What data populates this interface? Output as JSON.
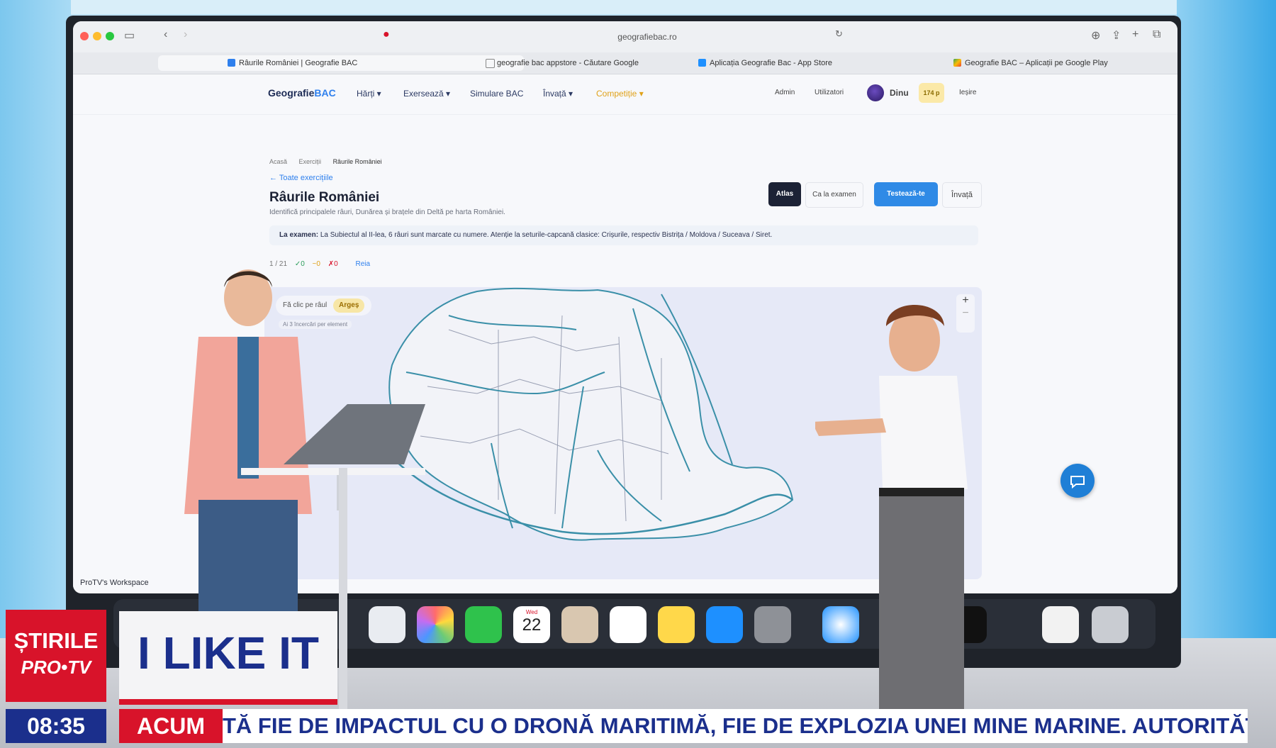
{
  "browser": {
    "url": "geografiebac.ro",
    "tabs": [
      {
        "label": "Râurile României | Geografie BAC"
      },
      {
        "label": "geografie bac appstore - Căutare Google"
      },
      {
        "label": "Aplicația Geografie Bac - App Store"
      },
      {
        "label": "Geografie BAC – Aplicații pe Google Play"
      }
    ]
  },
  "nav": {
    "logo_main": "Geografie",
    "logo_accent": "BAC",
    "items": [
      "Hărți ▾",
      "Exersează ▾",
      "Simulare BAC",
      "Învață ▾",
      "Competiție ▾"
    ],
    "admin": "Admin",
    "users": "Utilizatori",
    "user_name": "Dinu",
    "points": "174 p",
    "logout": "Ieșire"
  },
  "breadcrumb": [
    "Acasă",
    "Exerciții",
    "Râurile României"
  ],
  "back_link": "← Toate exercițiile",
  "page": {
    "title": "Râurile României",
    "subtitle": "Identifică principalele râuri, Dunărea și brațele din Deltă pe harta României."
  },
  "modes": {
    "atlas": "Atlas",
    "exam": "Ca la examen",
    "test": "Testează-te",
    "learn": "Învață"
  },
  "exam_note": {
    "label": "La examen:",
    "text": "La Subiectul al II-lea, 6 râuri sunt marcate cu numere. Atenție la seturile-capcană clasice: Crișurile, respectiv Bistrița / Moldova / Suceava / Siret."
  },
  "stats": {
    "progress": "1 / 21",
    "correct": "✓0",
    "partial": "~0",
    "wrong": "✗0",
    "reset": "Reia"
  },
  "map": {
    "prompt": "Fă clic pe râul",
    "river": "Argeș",
    "hint": "Ai 3 încercări per element",
    "zoom_in": "+",
    "zoom_out": "−"
  },
  "workspace": "ProTV's Workspace",
  "dock": {
    "calendar_month": "Wed",
    "calendar_day": "22"
  },
  "broadcast": {
    "channel_line1": "ȘTIRILE",
    "channel_line2": "PRO•TV",
    "show": "I LIKE IT",
    "time": "08:35",
    "now": "ACUM",
    "ticker": "TĂ FIE DE IMPACTUL CU O DRONĂ MARITIMĂ, FIE DE EXPLOZIA UNEI MINE MARINE. AUTORITĂȚILE MONITO"
  },
  "colors": {
    "accent": "#2f80ed",
    "brand_red": "#d8132a",
    "brand_blue": "#1b2f8c",
    "river": "#3a8fa8"
  }
}
